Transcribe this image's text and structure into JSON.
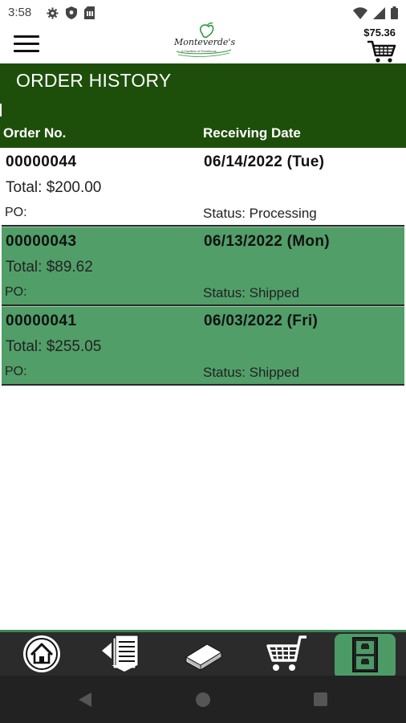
{
  "status_bar": {
    "time": "3:58",
    "left_icons": [
      "gear-icon",
      "shield-icon",
      "sim-card-icon"
    ],
    "right_icons": [
      "wifi-icon",
      "signal-icon",
      "battery-icon"
    ]
  },
  "header": {
    "menu_icon": "hamburger-menu-icon",
    "logo_text": "Monteverde's",
    "logo_subtext": "A Tradition of Excellence",
    "cart_total": "$75.36",
    "cart_icon": "shopping-cart-icon"
  },
  "page": {
    "title": "ORDER HISTORY",
    "columns": {
      "order_no": "Order No.",
      "receiving_date": "Receiving Date"
    }
  },
  "orders": [
    {
      "order_no": "00000044",
      "date": "06/14/2022 (Tue)",
      "total": "Total: $200.00",
      "po": "PO:",
      "status": "Status: Processing"
    },
    {
      "order_no": "00000043",
      "date": "06/13/2022 (Mon)",
      "total": "Total: $89.62",
      "po": "PO:",
      "status": "Status: Shipped"
    },
    {
      "order_no": "00000041",
      "date": "06/03/2022 (Fri)",
      "total": "Total: $255.05",
      "po": "PO:",
      "status": "Status: Shipped"
    }
  ],
  "bottom_nav": {
    "items": [
      {
        "icon": "home-icon",
        "active": false
      },
      {
        "icon": "order-list-icon",
        "active": false
      },
      {
        "icon": "catalog-book-icon",
        "active": false
      },
      {
        "icon": "cart-icon",
        "active": false
      },
      {
        "icon": "order-history-icon",
        "active": true
      }
    ]
  },
  "colors": {
    "banner": "#1d4f0b",
    "row_highlight": "#519e68",
    "nav_background": "#2b2b2b",
    "nav_active": "#4c9b66"
  }
}
